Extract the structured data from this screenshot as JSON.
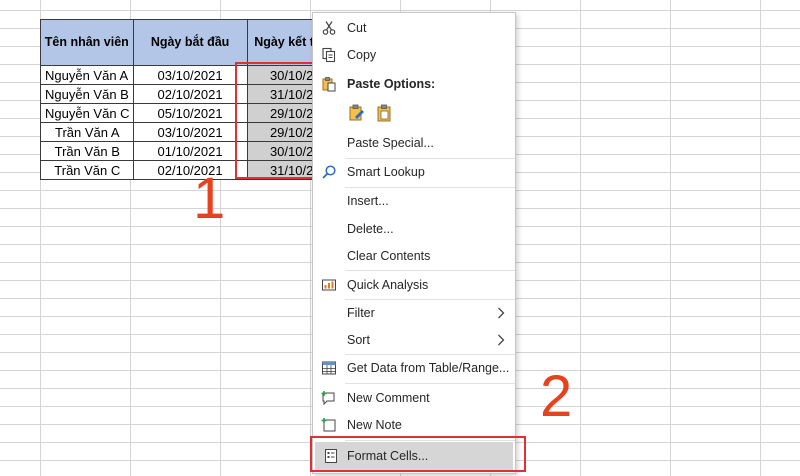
{
  "table": {
    "headers": [
      "Tên nhân viên",
      "Ngày bắt đầu",
      "Ngày kết t"
    ],
    "rows": [
      [
        "Nguyễn Văn A",
        "03/10/2021",
        "30/10/20"
      ],
      [
        "Nguyễn Văn B",
        "02/10/2021",
        "31/10/20"
      ],
      [
        "Nguyễn Văn C",
        "05/10/2021",
        "29/10/20"
      ],
      [
        "Trần Văn A",
        "03/10/2021",
        "29/10/20"
      ],
      [
        "Trần Văn B",
        "01/10/2021",
        "30/10/20"
      ],
      [
        "Trần Văn C",
        "02/10/2021",
        "31/10/20"
      ]
    ]
  },
  "annotations": {
    "step1": "1",
    "step2": "2"
  },
  "menu": {
    "cut": "Cut",
    "copy": "Copy",
    "paste_options": "Paste Options:",
    "paste_special": "Paste Special...",
    "smart_lookup": "Smart Lookup",
    "insert": "Insert...",
    "delete": "Delete...",
    "clear_contents": "Clear Contents",
    "quick_analysis": "Quick Analysis",
    "filter": "Filter",
    "sort": "Sort",
    "get_data": "Get Data from Table/Range...",
    "new_comment": "New Comment",
    "new_note": "New Note",
    "format_cells": "Format Cells..."
  },
  "colors": {
    "header_fill": "#b4c6e7",
    "selection_fill": "#d0d0d0",
    "highlight_red": "#e03030",
    "step_number": "#e8411e",
    "menu_hover": "#d6d6d6"
  }
}
